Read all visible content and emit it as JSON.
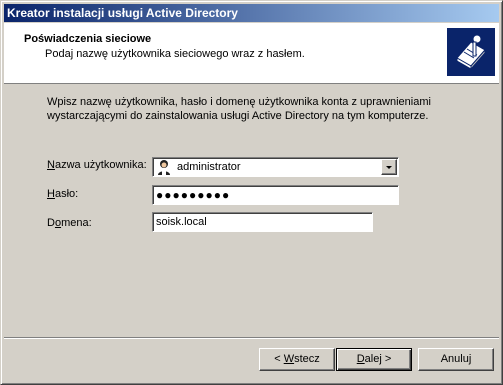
{
  "window": {
    "title": "Kreator instalacji usługi Active Directory"
  },
  "header": {
    "title": "Poświadczenia sieciowe",
    "subtitle": "Podaj nazwę użytkownika sieciowego wraz z hasłem.",
    "icon": "book-key-icon"
  },
  "intro_text": "Wpisz nazwę użytkownika, hasło i domenę użytkownika konta z uprawnieniami wystarczającymi do zainstalowania usługi Active Directory na tym komputerze.",
  "form": {
    "username": {
      "label_pre": "",
      "label_u": "N",
      "label_post": "azwa użytkownika:",
      "value": "administrator",
      "icon": "user-icon"
    },
    "password": {
      "label_pre": "",
      "label_u": "H",
      "label_post": "asło:",
      "value": "●●●●●●●●●"
    },
    "domain": {
      "label_pre": "D",
      "label_u": "o",
      "label_post": "mena:",
      "value": "soisk.local"
    }
  },
  "buttons": {
    "back": {
      "pre": "< ",
      "u": "W",
      "post": "stecz"
    },
    "next": {
      "pre": "",
      "u": "D",
      "post": "alej >"
    },
    "cancel": {
      "label": "Anuluj"
    }
  },
  "colors": {
    "titlebar_start": "#0a246a",
    "titlebar_end": "#a6caf0",
    "face": "#d4d0c8"
  }
}
